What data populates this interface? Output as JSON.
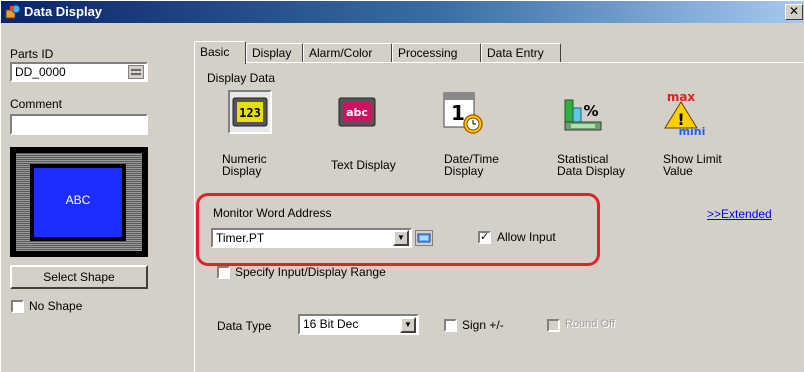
{
  "window": {
    "title": "Data Display",
    "close_label": "✕"
  },
  "left": {
    "parts_id_label": "Parts ID",
    "parts_id_value": "DD_0000",
    "comment_label": "Comment",
    "comment_value": "",
    "preview_text": "ABC",
    "select_shape_label": "Select Shape",
    "no_shape_label": "No Shape"
  },
  "tabs": [
    {
      "label": "Basic"
    },
    {
      "label": "Display"
    },
    {
      "label": "Alarm/Color"
    },
    {
      "label": "Processing"
    },
    {
      "label": "Data Entry"
    }
  ],
  "display_data": {
    "section_label": "Display Data",
    "items": [
      {
        "line1": "Numeric",
        "line2": "Display",
        "icon": "numeric-display-icon",
        "icon_text": "123"
      },
      {
        "line1": "Text Display",
        "line2": "",
        "icon": "text-display-icon",
        "icon_text": "abc"
      },
      {
        "line1": "Date/Time",
        "line2": "Display",
        "icon": "date-time-display-icon",
        "icon_text": "1"
      },
      {
        "line1": "Statistical",
        "line2": "Data Display",
        "icon": "statistical-data-icon",
        "icon_text": "%"
      },
      {
        "line1": "Show Limit",
        "line2": "Value",
        "icon": "show-limit-icon",
        "icon_text": "max",
        "icon_text2": "mini"
      }
    ]
  },
  "monitor": {
    "label": "Monitor Word Address",
    "value": "Timer.PT",
    "extended_link": ">>Extended",
    "allow_input_label": "Allow Input",
    "allow_input_checked": "✓"
  },
  "specify_range_label": "Specify Input/Display Range",
  "data_type": {
    "label": "Data Type",
    "value": "16 Bit Dec",
    "sign_label": "Sign +/-",
    "round_off_label": "Round Off"
  },
  "colors": {
    "highlight": "#e5202a",
    "preview_blue": "#1c2dff",
    "link": "#0000ee"
  }
}
